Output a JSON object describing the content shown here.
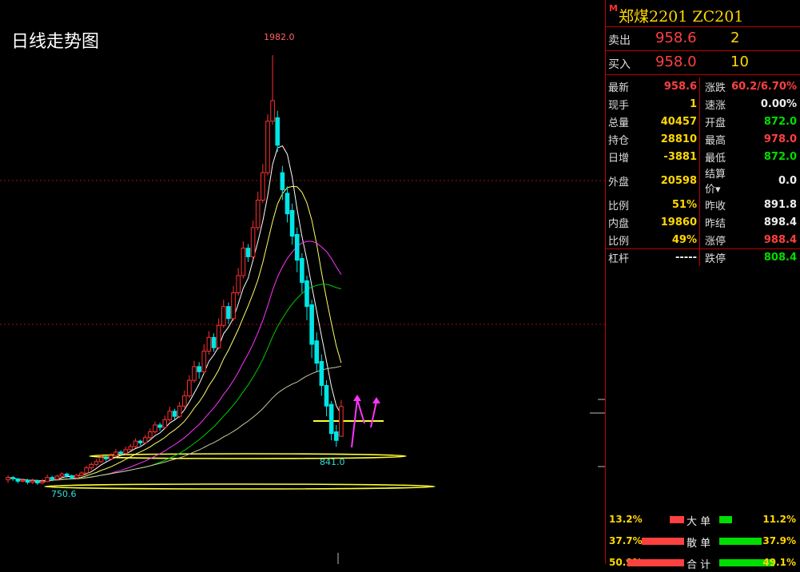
{
  "chart_title": "日线走势图",
  "instrument": {
    "mark": "M",
    "title": "郑煤2201  ZC201"
  },
  "quotes": [
    {
      "label": "卖出",
      "price": "958.6",
      "volume": "2"
    },
    {
      "label": "买入",
      "price": "958.0",
      "volume": "10"
    }
  ],
  "stats": [
    {
      "k1": "最新",
      "v1": "958.6",
      "c1": "red",
      "k2": "涨跌",
      "v2": "60.2/6.70%",
      "c2": "red"
    },
    {
      "k1": "现手",
      "v1": "1",
      "c1": "yel",
      "k2": "速涨",
      "v2": "0.00%",
      "c2": "wht"
    },
    {
      "k1": "总量",
      "v1": "40457",
      "c1": "yel",
      "k2": "开盘",
      "v2": "872.0",
      "c2": "grn"
    },
    {
      "k1": "持仓",
      "v1": "28810",
      "c1": "yel",
      "k2": "最高",
      "v2": "978.0",
      "c2": "red"
    },
    {
      "k1": "日增",
      "v1": "-3881",
      "c1": "yel",
      "k2": "最低",
      "v2": "872.0",
      "c2": "grn"
    },
    {
      "k1": "外盘",
      "v1": "20598",
      "c1": "yel",
      "k2": "结算价▾",
      "v2": "0.0",
      "c2": "wht"
    },
    {
      "k1": "比例",
      "v1": "51%",
      "c1": "yel",
      "k2": "昨收",
      "v2": "891.8",
      "c2": "wht"
    },
    {
      "k1": "内盘",
      "v1": "19860",
      "c1": "yel",
      "k2": "昨结",
      "v2": "898.4",
      "c2": "wht"
    },
    {
      "k1": "比例",
      "v1": "49%",
      "c1": "yel",
      "k2": "涨停",
      "v2": "988.4",
      "c2": "red"
    },
    {
      "k1": "杠杆",
      "v1": "-----",
      "c1": "wht",
      "k2": "跌停",
      "v2": "808.4",
      "c2": "grn"
    }
  ],
  "flows": [
    {
      "left_pct": "13.2%",
      "name": "大 单",
      "red": 0.132,
      "green": 0.112,
      "right_pct": "11.2%"
    },
    {
      "left_pct": "37.7%",
      "name": "散 单",
      "red": 0.377,
      "green": 0.379,
      "right_pct": "37.9%"
    },
    {
      "left_pct": "50.9%",
      "name": "合 计",
      "red": 0.509,
      "green": 0.491,
      "right_pct": "49.1%"
    }
  ],
  "chart_data": {
    "type": "candlestick",
    "title": "日线走势图",
    "ylim": [
      700,
      2050
    ],
    "annotations": {
      "high_label": "1982.0",
      "low_label": "750.6",
      "recent_low_label": "841.0"
    },
    "colors": {
      "up": "#ff3030",
      "down": "#00e5e5",
      "ma5": "#ffffff",
      "ma10": "#ffff66",
      "ma20": "#ff33ff",
      "ma30": "#00cc00",
      "ma60": "#c8c8a0",
      "support": "#ffff33",
      "arrow": "#ff33ff"
    },
    "candles": [
      [
        745,
        752,
        736,
        758
      ],
      [
        752,
        748,
        742,
        756
      ],
      [
        748,
        741,
        735,
        750
      ],
      [
        741,
        744,
        738,
        749
      ],
      [
        744,
        738,
        732,
        748
      ],
      [
        738,
        742,
        733,
        749
      ],
      [
        742,
        736,
        730,
        746
      ],
      [
        736,
        740,
        732,
        748
      ],
      [
        740,
        752,
        738,
        760
      ],
      [
        752,
        747,
        741,
        757
      ],
      [
        747,
        756,
        744,
        760
      ],
      [
        756,
        762,
        753,
        767
      ],
      [
        762,
        757,
        751,
        766
      ],
      [
        757,
        751,
        746,
        760
      ],
      [
        751,
        758,
        748,
        763
      ],
      [
        758,
        765,
        755,
        770
      ],
      [
        765,
        780,
        761,
        786
      ],
      [
        780,
        790,
        774,
        796
      ],
      [
        790,
        798,
        785,
        805
      ],
      [
        798,
        810,
        794,
        818
      ],
      [
        810,
        806,
        799,
        815
      ],
      [
        806,
        816,
        802,
        823
      ],
      [
        816,
        826,
        811,
        835
      ],
      [
        826,
        822,
        815,
        831
      ],
      [
        822,
        833,
        817,
        842
      ],
      [
        833,
        842,
        829,
        850
      ],
      [
        842,
        858,
        838,
        866
      ],
      [
        858,
        853,
        845,
        862
      ],
      [
        853,
        868,
        849,
        876
      ],
      [
        868,
        885,
        862,
        895
      ],
      [
        885,
        905,
        879,
        915
      ],
      [
        905,
        898,
        888,
        912
      ],
      [
        898,
        920,
        893,
        932
      ],
      [
        920,
        945,
        915,
        958
      ],
      [
        945,
        930,
        922,
        952
      ],
      [
        930,
        960,
        925,
        972
      ],
      [
        960,
        990,
        954,
        1005
      ],
      [
        990,
        1035,
        983,
        1050
      ],
      [
        1035,
        1075,
        1028,
        1092
      ],
      [
        1075,
        1060,
        1040,
        1088
      ],
      [
        1060,
        1120,
        1055,
        1140
      ],
      [
        1120,
        1160,
        1110,
        1178
      ],
      [
        1160,
        1130,
        1118,
        1172
      ],
      [
        1130,
        1195,
        1125,
        1215
      ],
      [
        1195,
        1250,
        1188,
        1270
      ],
      [
        1250,
        1215,
        1200,
        1262
      ],
      [
        1215,
        1290,
        1208,
        1310
      ],
      [
        1290,
        1340,
        1282,
        1362
      ],
      [
        1340,
        1420,
        1332,
        1440
      ],
      [
        1420,
        1395,
        1380,
        1432
      ],
      [
        1395,
        1480,
        1388,
        1500
      ],
      [
        1480,
        1560,
        1472,
        1585
      ],
      [
        1560,
        1640,
        1552,
        1665
      ],
      [
        1640,
        1790,
        1632,
        1810
      ],
      [
        1790,
        1850,
        1780,
        1982
      ],
      [
        1800,
        1720,
        1700,
        1820
      ],
      [
        1640,
        1590,
        1560,
        1660
      ],
      [
        1580,
        1520,
        1495,
        1600
      ],
      [
        1530,
        1455,
        1430,
        1550
      ],
      [
        1460,
        1385,
        1350,
        1480
      ],
      [
        1390,
        1320,
        1290,
        1405
      ],
      [
        1325,
        1250,
        1210,
        1340
      ],
      [
        1255,
        1140,
        1100,
        1270
      ],
      [
        1150,
        1085,
        1060,
        1175
      ],
      [
        1090,
        1020,
        990,
        1110
      ],
      [
        1020,
        960,
        930,
        1035
      ],
      [
        965,
        880,
        860,
        975
      ],
      [
        885,
        860,
        841,
        905
      ],
      [
        872,
        958.6,
        872,
        978
      ]
    ]
  }
}
